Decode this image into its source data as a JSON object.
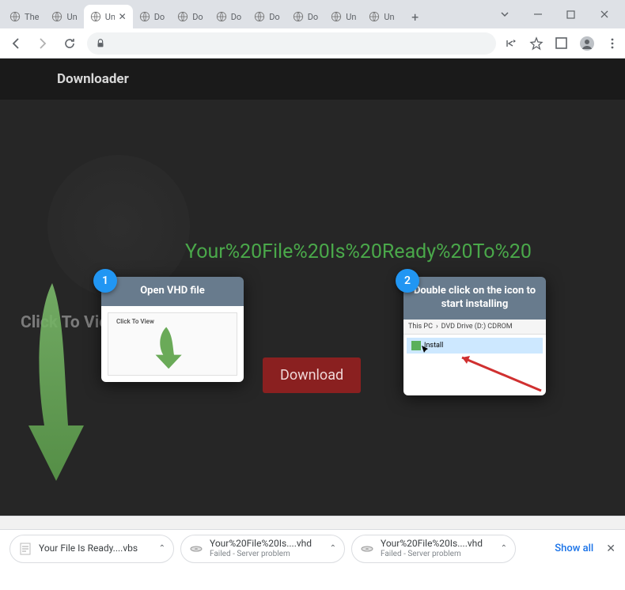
{
  "tabs": [
    {
      "title": "The"
    },
    {
      "title": "Un"
    },
    {
      "title": "Un",
      "active": true
    },
    {
      "title": "Do"
    },
    {
      "title": "Do"
    },
    {
      "title": "Do"
    },
    {
      "title": "Do"
    },
    {
      "title": "Do"
    },
    {
      "title": "Un"
    },
    {
      "title": "Un"
    }
  ],
  "page": {
    "brand": "Downloader",
    "headline": "Your%20File%20Is%20Ready%20To%20",
    "click_label": "Click To View",
    "download_btn": "Download",
    "watermark": "",
    "step1": {
      "num": "1",
      "title": "Open VHD file",
      "inner_label": "Click To View"
    },
    "step2": {
      "num": "2",
      "title": "Double click on the icon to start installing",
      "crumb_a": "This PC",
      "crumb_b": "DVD Drive (D:) CDROM",
      "item": "Install"
    }
  },
  "shelf": {
    "items": [
      {
        "name": "Your File Is Ready....vbs",
        "sub": ""
      },
      {
        "name": "Your%20File%20Is....vhd",
        "sub": "Failed - Server problem"
      },
      {
        "name": "Your%20File%20Is....vhd",
        "sub": "Failed - Server problem"
      }
    ],
    "show_all": "Show all"
  }
}
